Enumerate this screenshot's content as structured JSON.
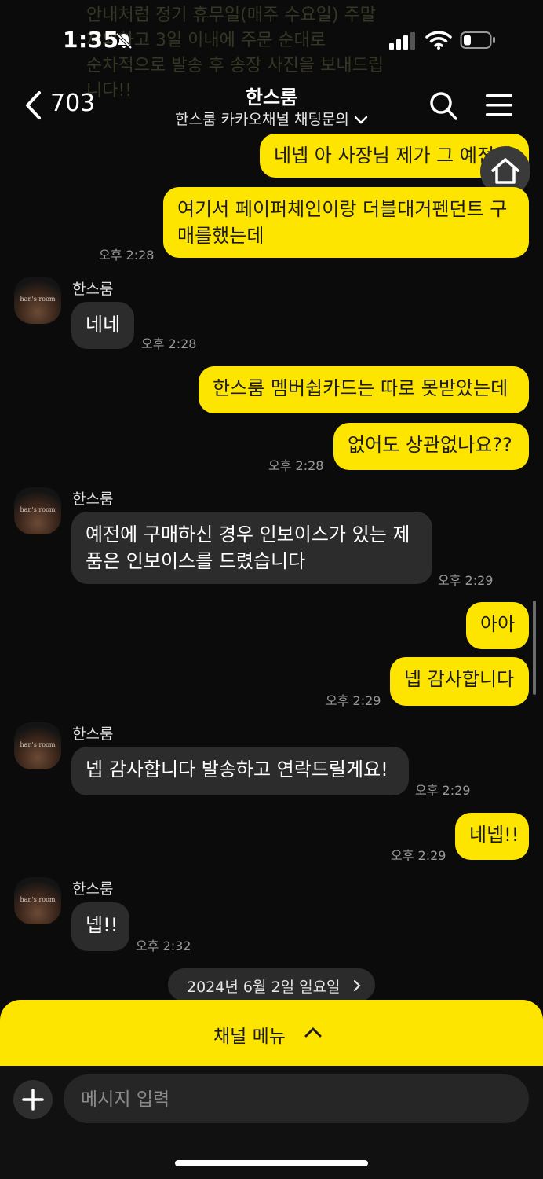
{
  "status": {
    "time": "1:35"
  },
  "notification_overlay": "안내처럼 정기 휴무일(매주 수요일) 주말\n제외하고 3일 이내에 주문 순대로\n순차적으로 발송 후 송장 사진을 보내드립\n니다!!",
  "header": {
    "unread_count": "703",
    "title": "한스룸",
    "subtitle": "한스룸 카카오채널 채팅문의"
  },
  "avatar_text": "han's room",
  "messages": [
    {
      "side": "me",
      "text": "네넵 아 사장님 제가 그 예전에"
    },
    {
      "side": "me",
      "text": "여기서 페이퍼체인이랑 더블대거펜던트 구매를했는데",
      "time": "오후 2:28"
    },
    {
      "side": "them",
      "sender": "한스룸",
      "text": "네네",
      "time": "오후 2:28"
    },
    {
      "side": "me",
      "text": "한스룸 멤버쉽카드는 따로 못받았는데"
    },
    {
      "side": "me",
      "text": "없어도 상관없나요??",
      "time": "오후 2:28"
    },
    {
      "side": "them",
      "sender": "한스룸",
      "text": "예전에 구매하신 경우 인보이스가 있는 제품은 인보이스를 드렸습니다",
      "time": "오후 2:29"
    },
    {
      "side": "me",
      "text": "아아"
    },
    {
      "side": "me",
      "text": "넵 감사합니다",
      "time": "오후 2:29"
    },
    {
      "side": "them",
      "sender": "한스룸",
      "text": "넵 감사합니다 발송하고 연락드릴게요!",
      "time": "오후 2:29"
    },
    {
      "side": "me",
      "text": "네넵!!",
      "time": "오후 2:29"
    },
    {
      "side": "them",
      "sender": "한스룸",
      "text": "넵!!",
      "time": "오후 2:32"
    }
  ],
  "date_divider": "2024년 6월 2일 일요일",
  "channel_menu": "채널 메뉴",
  "input": {
    "placeholder": "메시지 입력"
  },
  "colors": {
    "my_bubble": "#fee500",
    "their_bubble": "#2c2c2c",
    "background": "#0b0b0b"
  }
}
